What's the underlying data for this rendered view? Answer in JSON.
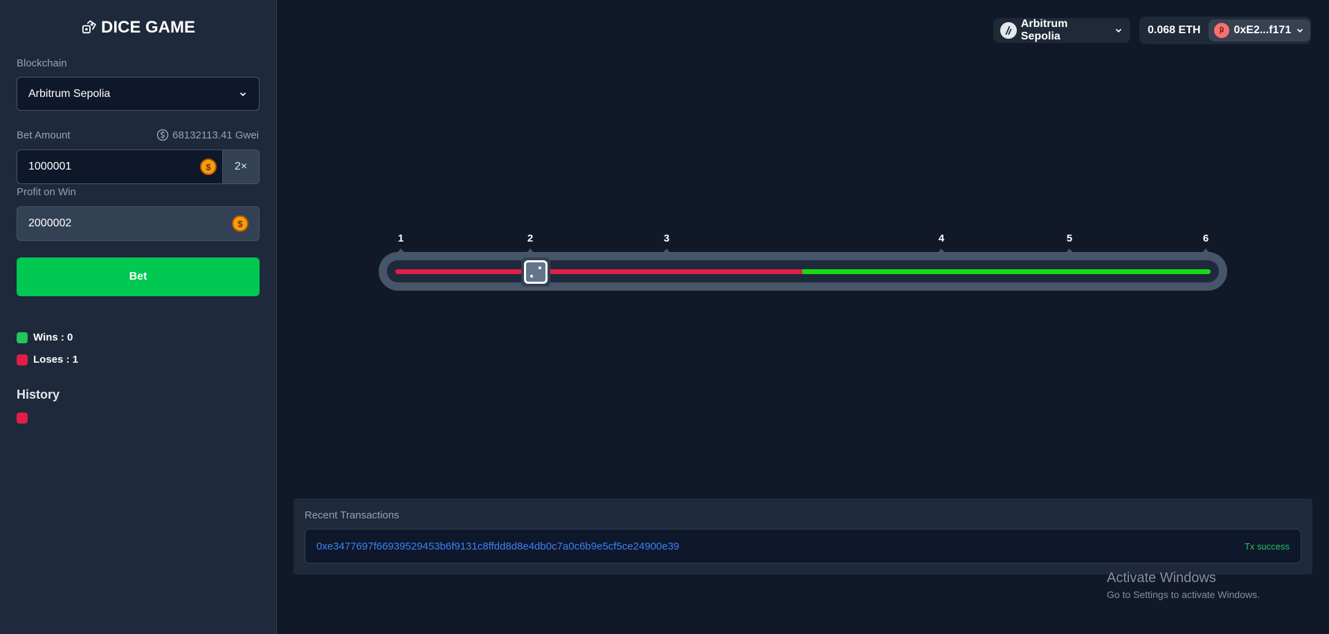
{
  "brand": {
    "title": "DICE GAME",
    "icon": "dice-icon"
  },
  "form": {
    "blockchain_label": "Blockchain",
    "blockchain_value": "Arbitrum Sepolia",
    "bet_label": "Bet Amount",
    "balance_hint": "68132113.41 Gwei",
    "bet_value": "1000001",
    "multiplier": "2×",
    "profit_label": "Profit on Win",
    "profit_value": "2000002",
    "coin_symbol": "$",
    "bet_button": "Bet"
  },
  "stats": {
    "wins": "Wins : 0",
    "loses": "Loses : 1",
    "win_color": "#22c55e",
    "lose_color": "#e11d48"
  },
  "history": {
    "title": "History",
    "results": [
      "lose"
    ]
  },
  "topbar": {
    "network": "Arbitrum Sepolia",
    "balance": "0.068 ETH",
    "account": "0xE2...f171"
  },
  "slider": {
    "ticks": [
      "1",
      "2",
      "3",
      "4",
      "5",
      "6"
    ],
    "current_value": 2,
    "lose_color": "#e11d48",
    "win_color": "#16dc16"
  },
  "transactions": {
    "title": "Recent Transactions",
    "items": [
      {
        "hash": "0xe3477697f66939529453b6f9131c8ffdd8d8e4db0c7a0c6b9e5cf5ce24900e39",
        "status": "Tx success"
      }
    ]
  },
  "watermark": {
    "title": "Activate Windows",
    "subtitle": "Go to Settings to activate Windows."
  }
}
